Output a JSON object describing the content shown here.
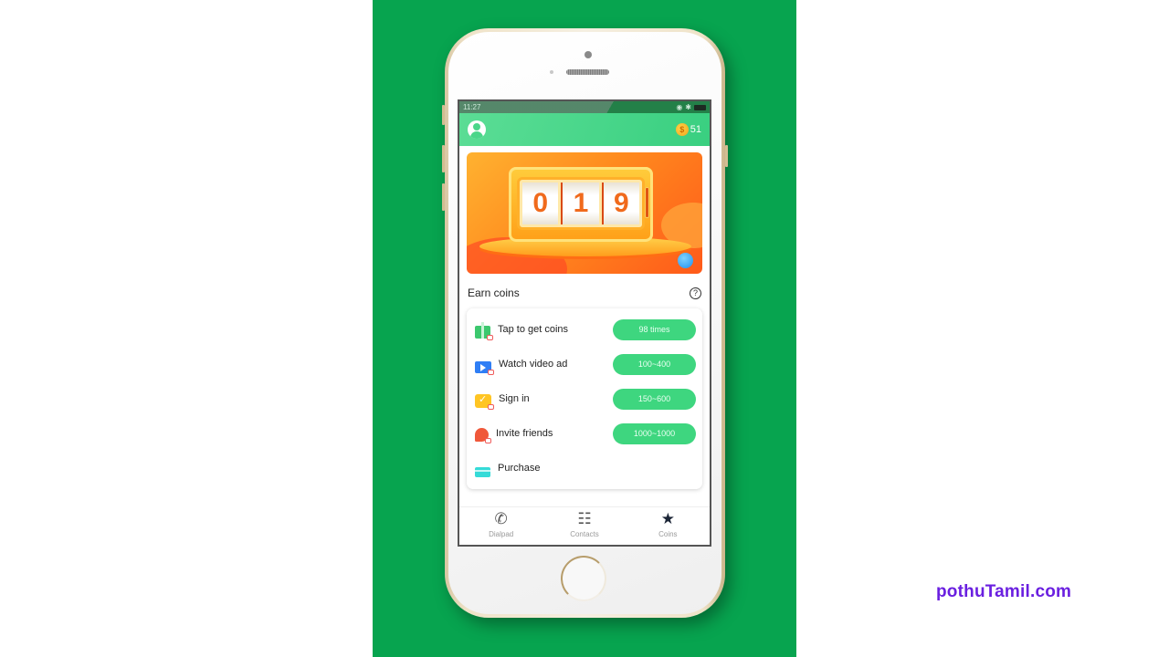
{
  "statusbar": {
    "time": "11:27",
    "icons": [
      "sim-icon",
      "wifi-icon",
      "alarm-icon",
      "bluetooth-icon",
      "battery-icon"
    ]
  },
  "appbar": {
    "coin_count": "51",
    "coin_symbol": "$"
  },
  "banner": {
    "reel_digits": [
      "0",
      "1",
      "9"
    ]
  },
  "earn": {
    "title": "Earn coins",
    "help_symbol": "?",
    "items": [
      {
        "label": "Tap to get coins",
        "pill": "98 times",
        "icon": "gift-icon"
      },
      {
        "label": "Watch video ad",
        "pill": "100~400",
        "icon": "video-icon"
      },
      {
        "label": "Sign in",
        "pill": "150~600",
        "icon": "calendar-check-icon"
      },
      {
        "label": "Invite friends",
        "pill": "1000~1000",
        "icon": "invite-icon"
      },
      {
        "label": "Purchase",
        "pill": null,
        "icon": "card-icon"
      }
    ]
  },
  "tabs": [
    {
      "label": "Dialpad",
      "glyph": "✆",
      "active": false
    },
    {
      "label": "Contacts",
      "glyph": "☷",
      "active": false
    },
    {
      "label": "Coins",
      "glyph": "★",
      "active": true
    }
  ],
  "watermark": "pothuTamil.com",
  "colors": {
    "background_panel": "#07a44f",
    "accent": "#3ed67f",
    "watermark": "#6a1fe0"
  }
}
